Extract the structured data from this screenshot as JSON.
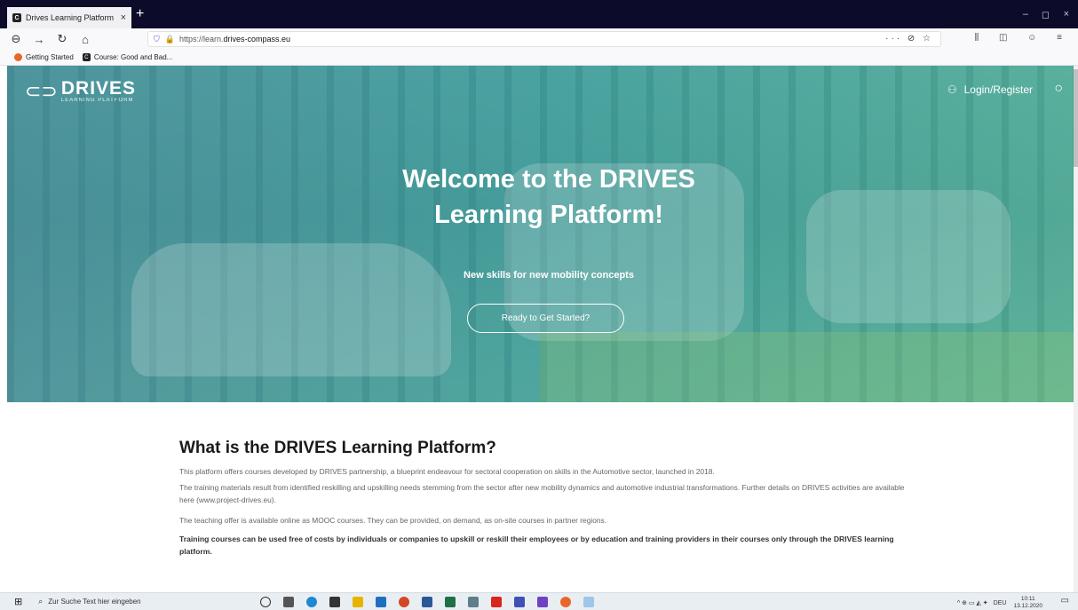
{
  "browser": {
    "tab_title": "Drives Learning Platform",
    "tab_close": "×",
    "new_tab": "+",
    "url_prefix": "https://learn.",
    "url_host": "drives-compass.eu",
    "url_actions": "··· ⊘ ☆",
    "toolbar_icons": "⫼ ◫ ☺ ≡",
    "window_controls": {
      "minimize": "–",
      "maximize": "◻",
      "close": "×"
    }
  },
  "bookmarks": [
    {
      "label": "Getting Started",
      "icon": "firefox-icon"
    },
    {
      "label": "Course: Good and Bad...",
      "icon": "course-icon"
    }
  ],
  "site": {
    "logo_text": "DRIVES",
    "logo_sub": "LEARNING PLATFORM",
    "login_label": "Login/Register",
    "hero_title": "Welcome to the DRIVES Learning Platform!",
    "hero_subtitle": "New skills for new mobility concepts",
    "cta_label": "Ready to Get Started?"
  },
  "content": {
    "heading": "What is the DRIVES Learning Platform?",
    "p1": "This platform offers courses developed by DRIVES partnership, a blueprint endeavour for sectoral cooperation on skills in the Automotive sector, launched in 2018.",
    "p2": "The training materials result from identified reskilling and upskilling  needs stemming from the sector after new mobility dynamics and  automotive industrial transformations. Further details on DRIVES  activities are available here (www.project-drives.eu).",
    "p3": "The teaching offer is available online as MOOC courses. They can be  provided, on demand, as on-site courses in partner regions.",
    "p4": "Training courses can be used free of costs by individuals or companies to upskill or reskill their employees or by education and training providers in their courses only through the DRIVES learning platform."
  },
  "taskbar": {
    "search_placeholder": "Zur Suche Text hier eingeben",
    "language": "DEU",
    "time": "10:11",
    "date": "13.12.2020"
  },
  "colors": {
    "accent_teal": "#3faaa5",
    "tab_bar": "#0c0c2a"
  }
}
